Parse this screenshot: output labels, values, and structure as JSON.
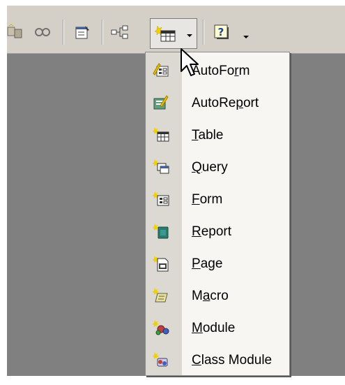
{
  "toolbar": {
    "buttons": [
      {
        "icon": "relationships-icon"
      },
      {
        "icon": "link-icon"
      },
      {
        "icon": "properties-icon"
      },
      {
        "icon": "relationships-diagram-icon"
      },
      {
        "icon": "new-object-table-icon"
      },
      {
        "icon": "help-icon"
      }
    ]
  },
  "menu": {
    "items": [
      {
        "label": "AutoForm",
        "mnemonic": "r",
        "icon": "autoform-icon"
      },
      {
        "label": "AutoReport",
        "mnemonic": "p",
        "icon": "autoreport-icon"
      },
      {
        "label": "Table",
        "mnemonic": "T",
        "icon": "new-table-icon"
      },
      {
        "label": "Query",
        "mnemonic": "Q",
        "icon": "new-query-icon"
      },
      {
        "label": "Form",
        "mnemonic": "F",
        "icon": "new-form-icon"
      },
      {
        "label": "Report",
        "mnemonic": "R",
        "icon": "new-report-icon"
      },
      {
        "label": "Page",
        "mnemonic": "P",
        "icon": "new-page-icon"
      },
      {
        "label": "Macro",
        "mnemonic": "a",
        "icon": "new-macro-icon"
      },
      {
        "label": "Module",
        "mnemonic": "M",
        "icon": "new-module-icon"
      },
      {
        "label": "Class Module",
        "mnemonic": "C",
        "icon": "new-class-module-icon"
      }
    ]
  },
  "colors": {
    "toolbar": "#d4d0c8",
    "app_background": "#808080",
    "menu_background": "#f7f6f3",
    "menu_stripe": "#dcd9d2"
  }
}
